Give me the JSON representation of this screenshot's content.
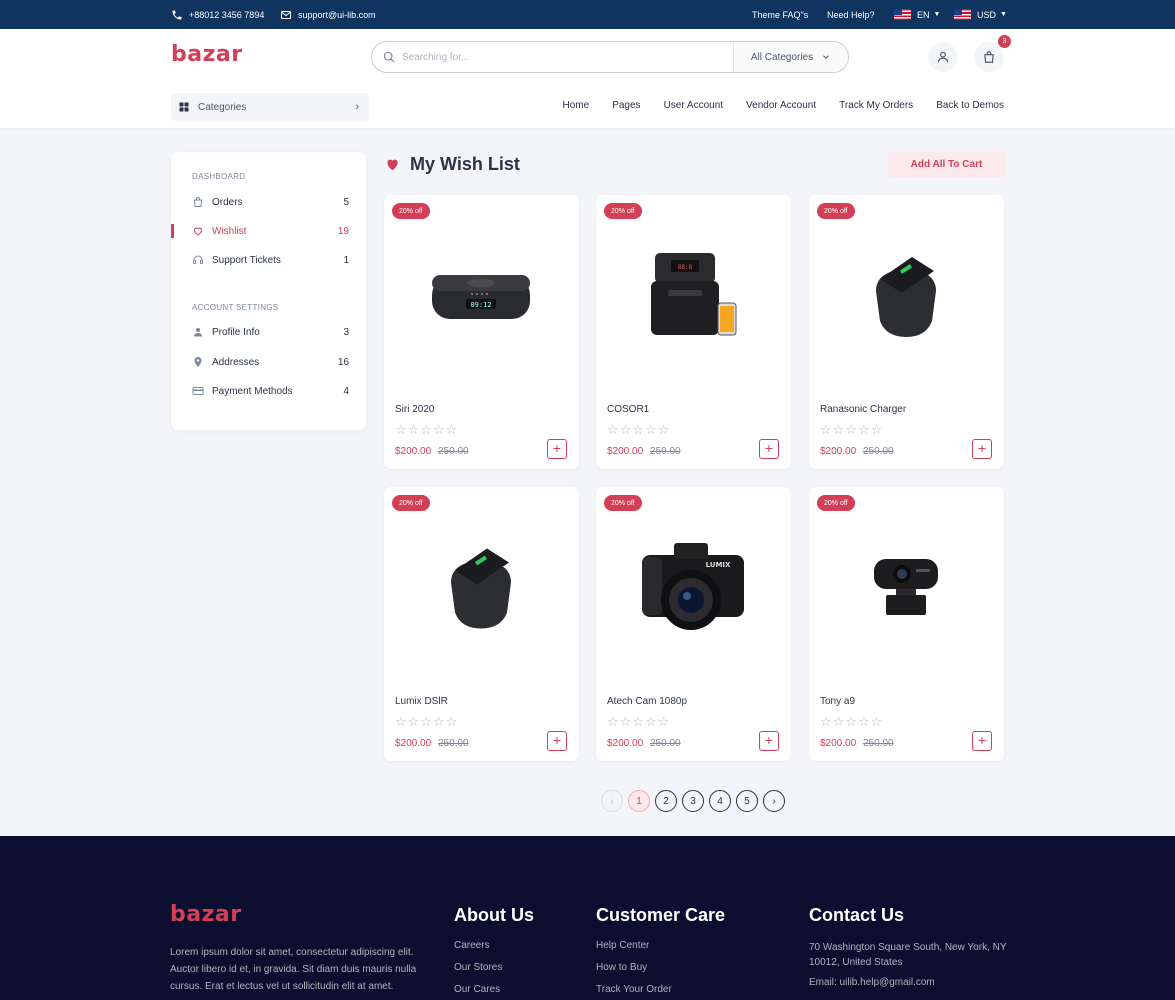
{
  "topbar": {
    "phone": "+88012 3456 7894",
    "email": "support@ui-lib.com",
    "faq": "Theme FAQ\"s",
    "help": "Need Help?",
    "language": "EN",
    "currency": "USD"
  },
  "header": {
    "logo_text": "bazar",
    "search_placeholder": "Searching for...",
    "search_category": "All Categories",
    "cart_count": "3",
    "categories_label": "Categories",
    "nav": [
      "Home",
      "Pages",
      "User Account",
      "Vendor Account",
      "Track My Orders",
      "Back to Demos"
    ]
  },
  "sidebar": {
    "dashboard_title": "DASHBOARD",
    "dashboard_items": [
      {
        "label": "Orders",
        "count": "5",
        "icon": "shopping-bag-icon"
      },
      {
        "label": "Wishlist",
        "count": "19",
        "icon": "heart-icon"
      },
      {
        "label": "Support Tickets",
        "count": "1",
        "icon": "headset-icon"
      }
    ],
    "settings_title": "ACCOUNT SETTINGS",
    "settings_items": [
      {
        "label": "Profile Info",
        "count": "3",
        "icon": "person-icon"
      },
      {
        "label": "Addresses",
        "count": "16",
        "icon": "location-pin-icon"
      },
      {
        "label": "Payment Methods",
        "count": "4",
        "icon": "credit-card-icon"
      }
    ]
  },
  "main": {
    "title": "My Wish List",
    "add_all_label": "Add All To Cart"
  },
  "products": [
    {
      "name": "Siri 2020",
      "discount": "20% off",
      "price": "$200.00",
      "old_price": "250.00",
      "image": "smart-speaker-dock"
    },
    {
      "name": "COSOR1",
      "discount": "20% off",
      "price": "$200.00",
      "old_price": "250.00",
      "image": "air-fryer"
    },
    {
      "name": "Ranasonic Charger",
      "discount": "20% off",
      "price": "$200.00",
      "old_price": "250.00",
      "image": "wireless-charger-speaker"
    },
    {
      "name": "Lumix DSlR",
      "discount": "20% off",
      "price": "$200.00",
      "old_price": "250.00",
      "image": "wireless-charger-speaker"
    },
    {
      "name": "Atech Cam 1080p",
      "discount": "20% off",
      "price": "$200.00",
      "old_price": "250.00",
      "image": "dslr-camera"
    },
    {
      "name": "Tony a9",
      "discount": "20% off",
      "price": "$200.00",
      "old_price": "250.00",
      "image": "webcam"
    }
  ],
  "pagination": {
    "pages": [
      "1",
      "2",
      "3",
      "4",
      "5"
    ],
    "current": "1"
  },
  "footer": {
    "logo_text": "bazar",
    "about_text": "Lorem ipsum dolor sit amet, consectetur adipiscing elit. Auctor libero id et, in gravida. Sit diam duis mauris nulla cursus. Erat et lectus vel ut sollicitudin elit at amet.",
    "about_title": "About Us",
    "about_links": [
      "Careers",
      "Our Stores",
      "Our Cares"
    ],
    "care_title": "Customer Care",
    "care_links": [
      "Help Center",
      "How to Buy",
      "Track Your Order"
    ],
    "contact_title": "Contact Us",
    "contact_address": "70 Washington Square South, New York, NY 10012, United States",
    "contact_email": "Email: uilib.help@gmail.com"
  },
  "colors": {
    "primary": "#d23f57",
    "topbar": "#0f3460",
    "footer": "#0c0e30"
  }
}
